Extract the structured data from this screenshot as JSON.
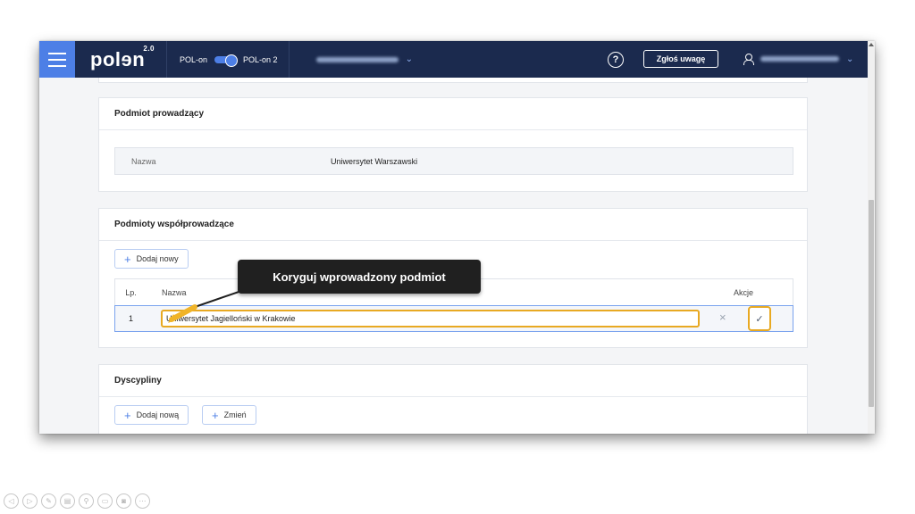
{
  "topbar": {
    "logo": "polɘn",
    "logo_version": "2.0",
    "env_left": "POL-on",
    "env_right": "POL-on 2",
    "help_symbol": "?",
    "report_button": "Zgłoś uwagę"
  },
  "section_main_unit": {
    "title": "Podmiot prowadzący",
    "label": "Nazwa",
    "value": "Uniwersytet Warszawski"
  },
  "section_co_units": {
    "title": "Podmioty współprowadzące",
    "add_button": "Dodaj nowy",
    "columns": {
      "lp": "Lp.",
      "name": "Nazwa",
      "actions": "Akcje"
    },
    "rows": [
      {
        "lp": "1",
        "name": "Uniwersytet Jagielloński w Krakowie"
      }
    ]
  },
  "section_disciplines": {
    "title": "Dyscypliny",
    "add_button": "Dodaj nową",
    "change_button": "Zmień"
  },
  "callout": {
    "text": "Koryguj wprowadzony podmiot"
  },
  "icons": {
    "plus": "+",
    "cancel": "×",
    "confirm": "✓",
    "chevron": "⌄"
  },
  "colors": {
    "topbar": "#1b2a4e",
    "accent": "#4d7fe6",
    "highlight": "#e8a922"
  }
}
